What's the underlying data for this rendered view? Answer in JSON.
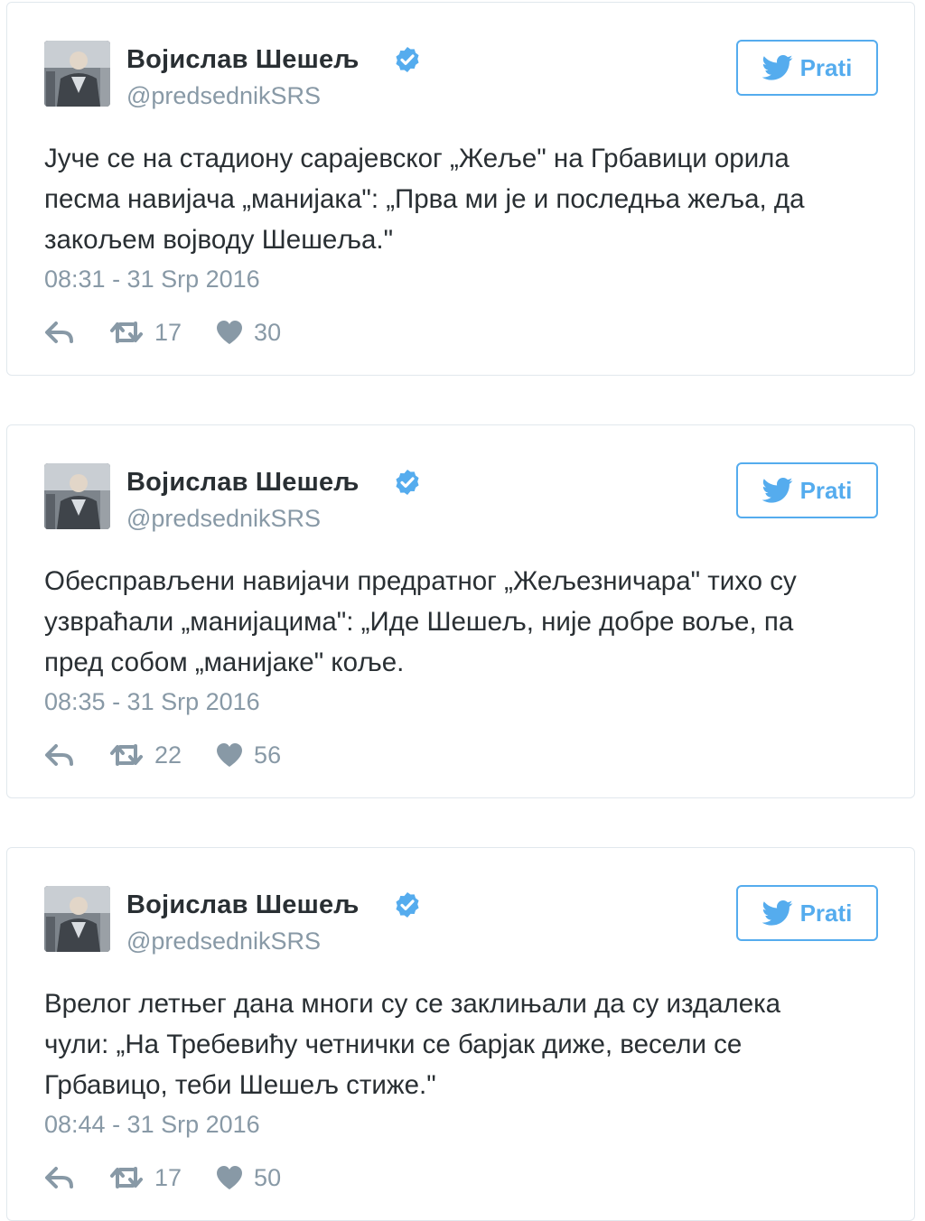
{
  "colors": {
    "accent": "#55acee",
    "text": "#292f33",
    "muted": "#8899a6",
    "border": "#e1e8ed"
  },
  "tweets": [
    {
      "author": {
        "name": "Војислав Шешељ",
        "handle": "@predsednikSRS",
        "verified": true
      },
      "follow_label": "Prati",
      "text_lines": [
        "Јуче се на стадиону сарајевског „Жеље\" на Грбавици орила",
        "песма навијача „манијака\": „Прва ми је и последња жеља, да",
        "закољем војводу Шешеља.\""
      ],
      "timestamp": "08:31 - 31 Srp 2016",
      "retweets": "17",
      "likes": "30"
    },
    {
      "author": {
        "name": "Војислав Шешељ",
        "handle": "@predsednikSRS",
        "verified": true
      },
      "follow_label": "Prati",
      "text_lines": [
        "Обесправљени навијачи предратног „Жељезничара\" тихо су",
        "узвраћали „манијацима\": „Иде Шешељ, није добре воље, па",
        "пред собом „манијаке\" коље."
      ],
      "timestamp": "08:35 - 31 Srp 2016",
      "retweets": "22",
      "likes": "56"
    },
    {
      "author": {
        "name": "Војислав Шешељ",
        "handle": "@predsednikSRS",
        "verified": true
      },
      "follow_label": "Prati",
      "text_lines": [
        "Врелог летњег дана многи су се заклињали да су издалека",
        "чули: „На Требевићу четнички се барјак диже, весели се",
        "Грбавицо, теби Шешељ стиже.\""
      ],
      "timestamp": "08:44 - 31 Srp 2016",
      "retweets": "17",
      "likes": "50"
    }
  ]
}
